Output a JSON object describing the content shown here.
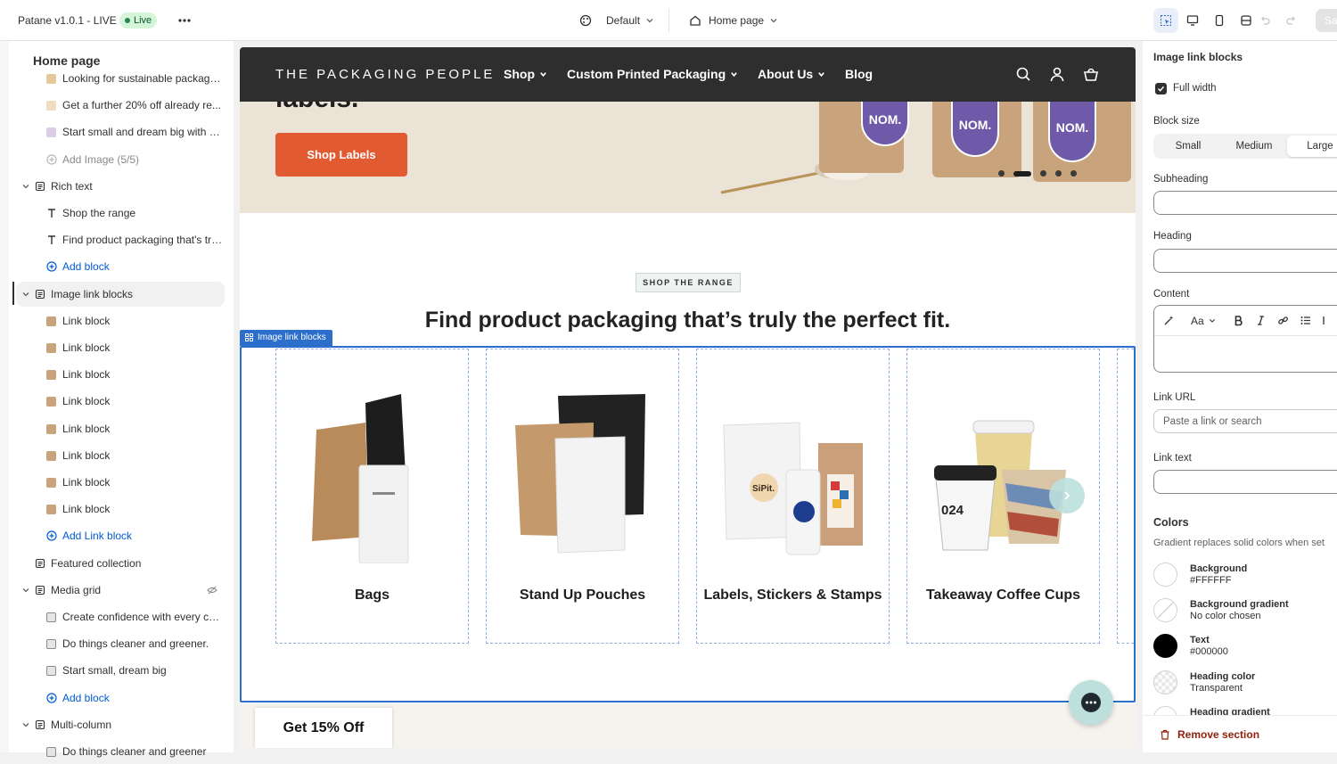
{
  "topbar": {
    "title": "Patane v1.0.1 - LIVE",
    "status_badge": "Live",
    "theme_select": "Default",
    "page_select": "Home page",
    "save_label": "Sa"
  },
  "left_panel": {
    "title": "Home page",
    "items": [
      {
        "label": "Looking for sustainable packagin...",
        "kind": "image-child"
      },
      {
        "label": "Get a further 20% off already re...",
        "kind": "image-child"
      },
      {
        "label": "Start small and dream big with a ...",
        "kind": "image-child"
      },
      {
        "label": "Add Image (5/5)",
        "kind": "add-disabled"
      },
      {
        "label": "Rich text",
        "kind": "section"
      },
      {
        "label": "Shop the range",
        "kind": "text-block"
      },
      {
        "label": "Find product packaging that's tru...",
        "kind": "text-block"
      },
      {
        "label": "Add block",
        "kind": "add"
      },
      {
        "label": "Image link blocks",
        "kind": "section-selected"
      },
      {
        "label": "Link block",
        "kind": "link"
      },
      {
        "label": "Link block",
        "kind": "link"
      },
      {
        "label": "Link block",
        "kind": "link"
      },
      {
        "label": "Link block",
        "kind": "link"
      },
      {
        "label": "Link block",
        "kind": "link"
      },
      {
        "label": "Link block",
        "kind": "link"
      },
      {
        "label": "Link block",
        "kind": "link"
      },
      {
        "label": "Link block",
        "kind": "link"
      },
      {
        "label": "Add Link block",
        "kind": "add"
      },
      {
        "label": "Featured collection",
        "kind": "section-flat"
      },
      {
        "label": "Media grid",
        "kind": "section-hidden"
      },
      {
        "label": "Create confidence with every cup.",
        "kind": "media"
      },
      {
        "label": "Do things cleaner and greener.",
        "kind": "media"
      },
      {
        "label": "Start small, dream big",
        "kind": "media"
      },
      {
        "label": "Add block",
        "kind": "add"
      },
      {
        "label": "Multi-column",
        "kind": "section"
      },
      {
        "label": "Do things cleaner and greener",
        "kind": "media"
      }
    ]
  },
  "site": {
    "brand": "THE PACKAGING PEOPLE",
    "nav": [
      "Shop",
      "Custom Printed Packaging",
      "About Us",
      "Blog"
    ],
    "hero_heading": "labels.",
    "hero_button": "Shop Labels",
    "hero_badge": "NOM.",
    "eyebrow": "SHOP THE RANGE",
    "section_heading": "Find product packaging that’s truly the perfect fit.",
    "section_tag": "Image link blocks",
    "cards": [
      "Bags",
      "Stand Up Pouches",
      "Labels, Stickers & Stamps",
      "Takeaway Coffee Cups"
    ],
    "product_text": {
      "sipit": "SiPit.",
      "cup_numbers": "024"
    },
    "promo": "Get 15% Off"
  },
  "right_panel": {
    "title": "Image link blocks",
    "full_width_label": "Full width",
    "full_width_checked": true,
    "block_size_label": "Block size",
    "block_sizes": [
      "Small",
      "Medium",
      "Large"
    ],
    "block_size_selected": "Large",
    "subheading_label": "Subheading",
    "heading_label": "Heading",
    "content_label": "Content",
    "rte_font": "Aa",
    "link_url_label": "Link URL",
    "link_url_placeholder": "Paste a link or search",
    "link_text_label": "Link text",
    "colors_label": "Colors",
    "colors_note": "Gradient replaces solid colors when set",
    "swatches": [
      {
        "name": "Background",
        "value": "#FFFFFF",
        "color": "#FFFFFF"
      },
      {
        "name": "Background gradient",
        "value": "No color chosen",
        "color": "none"
      },
      {
        "name": "Text",
        "value": "#000000",
        "color": "#000000"
      },
      {
        "name": "Heading color",
        "value": "Transparent",
        "color": "transparent"
      },
      {
        "name": "Heading gradient",
        "value": "",
        "color": "none"
      }
    ],
    "remove_label": "Remove section"
  },
  "colors": {
    "accent": "#2C6ECB",
    "hero_button": "#E25A32",
    "nav_bg": "#2E2E2E",
    "badge": "#6E5AA8",
    "danger": "#8E1F0B"
  }
}
